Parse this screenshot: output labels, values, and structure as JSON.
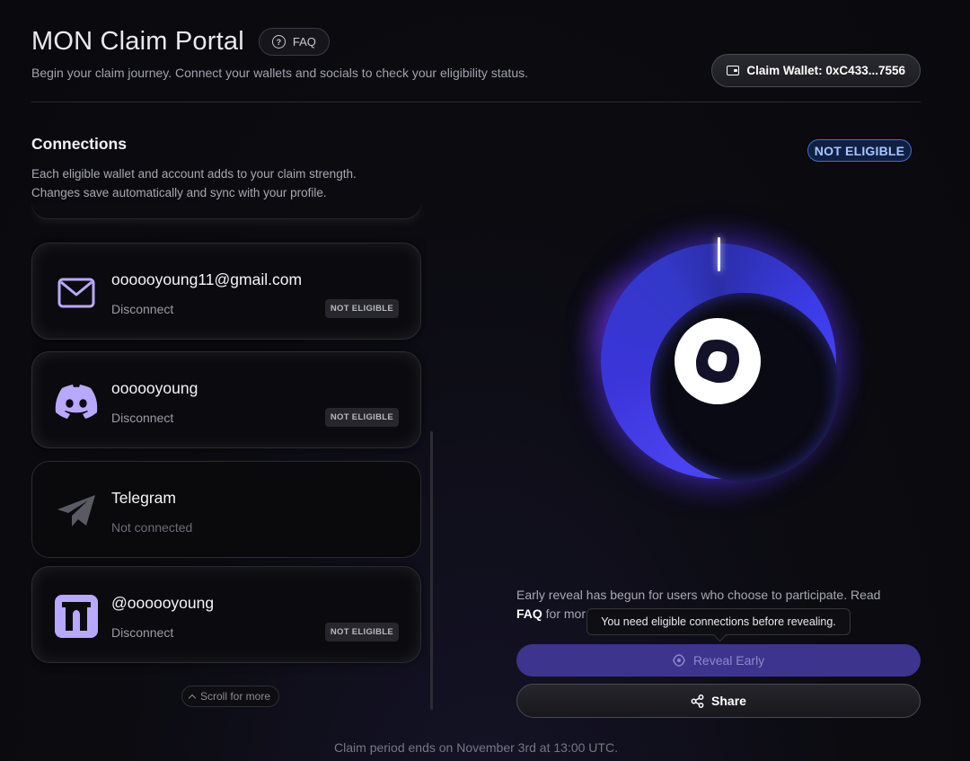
{
  "header": {
    "title": "MON Claim Portal",
    "faq_label": "FAQ",
    "subtitle": "Begin your claim journey. Connect your wallets and socials to check your eligibility status.",
    "wallet_label": "Claim Wallet: 0xC433...7556"
  },
  "connections": {
    "title": "Connections",
    "description_line1": "Each eligible wallet and account adds to your claim strength.",
    "description_line2": "Changes save automatically and sync with your profile.",
    "items": [
      {
        "icon": "mail-icon",
        "name": "oooooyoung11@gmail.com",
        "action": "Disconnect",
        "badge": "NOT ELIGIBLE"
      },
      {
        "icon": "discord-icon",
        "name": "oooooyoung",
        "action": "Disconnect",
        "badge": "NOT ELIGIBLE"
      },
      {
        "icon": "telegram-icon",
        "name": "Telegram",
        "action": "Not connected",
        "badge": ""
      },
      {
        "icon": "x-profile-icon",
        "name": "@oooooyoung",
        "action": "Disconnect",
        "badge": "NOT ELIGIBLE"
      }
    ],
    "scroll_hint": "Scroll for more"
  },
  "status": {
    "badge": "NOT ELIGIBLE",
    "accent": "#4d45ff",
    "badge_color": "#3f6fdb"
  },
  "reveal": {
    "text_before": "Early reveal has begun for users who choose to participate. Read",
    "faq_bold": "FAQ",
    "text_after": "for mor",
    "tooltip": "You need eligible connections before revealing.",
    "reveal_button": "Reveal Early",
    "share_button": "Share"
  },
  "footer": {
    "text": "Claim period ends on November 3rd at 13:00 UTC."
  }
}
